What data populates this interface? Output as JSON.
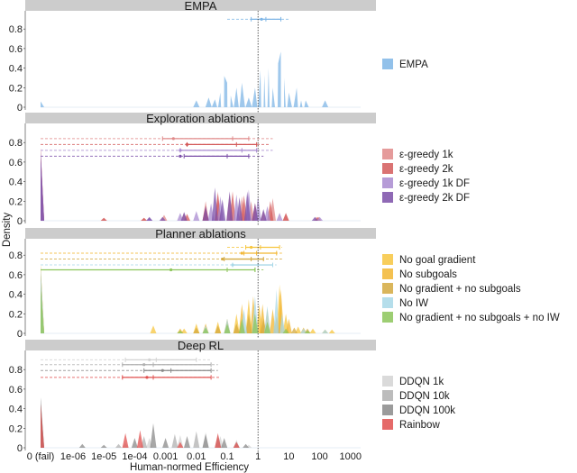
{
  "chart_data": {
    "type": "area",
    "title": "",
    "xlabel": "Human-normed Efficiency",
    "ylabel": "Density",
    "x_scale": "log10 with separate '0 (fail)' category",
    "x_ticks": [
      "0 (fail)",
      "1e-06",
      "1e-05",
      "1e-04",
      "0.001",
      "0.01",
      "0.1",
      "1",
      "10",
      "100",
      "1000"
    ],
    "y_ticks": [
      "0",
      "0.2",
      "0.4",
      "0.6",
      "0.8"
    ],
    "ylim": [
      0,
      0.95
    ],
    "reference_line": {
      "x": 1,
      "style": "dotted"
    },
    "legend_placement": "right",
    "panels": [
      {
        "title": "EMPA",
        "series": [
          {
            "name": "EMPA",
            "color": "#7fb6e6",
            "fail_density": 0.06,
            "peaks": [
              [
                0.01,
                0.07
              ],
              [
                0.025,
                0.1
              ],
              [
                0.04,
                0.08
              ],
              [
                0.06,
                0.15
              ],
              [
                0.08,
                0.32
              ],
              [
                0.1,
                0.25
              ],
              [
                0.13,
                0.12
              ],
              [
                0.2,
                0.2
              ],
              [
                0.3,
                0.25
              ],
              [
                0.5,
                0.1
              ],
              [
                0.8,
                0.2
              ],
              [
                1.2,
                0.38
              ],
              [
                1.6,
                0.33
              ],
              [
                2.2,
                0.4
              ],
              [
                3.0,
                0.2
              ],
              [
                4.5,
                0.45
              ],
              [
                5.5,
                0.57
              ],
              [
                7,
                0.3
              ],
              [
                10,
                0.15
              ],
              [
                18,
                0.2
              ],
              [
                25,
                0.07
              ],
              [
                35,
                0.07
              ],
              [
                150,
                0.07
              ]
            ],
            "interval": {
              "mean": 1.3,
              "inner": [
                0.6,
                1.8
              ],
              "outer": [
                0.6,
                5.5
              ],
              "dash_from": 0.1,
              "dash_to": 10,
              "level": 0.9
            }
          }
        ]
      },
      {
        "title": "Exploration ablations",
        "series": [
          {
            "name": "ε-greedy 1k",
            "color": "#e08a8a",
            "fail_density": 0.75,
            "peaks": [
              [
                1e-05,
                0.03
              ],
              [
                0.0002,
                0.03
              ],
              [
                0.0009,
                0.06
              ],
              [
                0.004,
                0.08
              ],
              [
                0.02,
                0.2
              ],
              [
                0.05,
                0.3
              ],
              [
                0.12,
                0.28
              ],
              [
                0.3,
                0.25
              ],
              [
                0.6,
                0.2
              ],
              [
                1.5,
                0.1
              ],
              [
                3,
                0.23
              ],
              [
                8,
                0.07
              ],
              [
                80,
                0.04
              ]
            ],
            "interval": {
              "mean": 0.0018,
              "inner": [
                0.0008,
                0.15
              ],
              "outer": [
                0.0008,
                0.5
              ],
              "dash_from": 0,
              "dash_to": 3,
              "level": 0.84
            }
          },
          {
            "name": "ε-greedy 2k",
            "color": "#d45a5a",
            "fail_density": 0.74,
            "peaks": [
              [
                1e-05,
                0.03
              ],
              [
                0.0002,
                0.03
              ],
              [
                0.005,
                0.07
              ],
              [
                0.02,
                0.15
              ],
              [
                0.05,
                0.28
              ],
              [
                0.15,
                0.3
              ],
              [
                0.35,
                0.26
              ],
              [
                0.8,
                0.18
              ],
              [
                2.5,
                0.2
              ],
              [
                8,
                0.08
              ],
              [
                90,
                0.04
              ]
            ],
            "interval": {
              "mean": 0.005,
              "inner": [
                0.005,
                0.2
              ],
              "outer": [
                0.005,
                0.9
              ],
              "dash_from": 0,
              "dash_to": 2.5,
              "level": 0.78
            }
          },
          {
            "name": "ε-greedy 1k DF",
            "color": "#a98bd0",
            "fail_density": 0.72,
            "peaks": [
              [
                0.0003,
                0.03
              ],
              [
                0.003,
                0.08
              ],
              [
                0.01,
                0.1
              ],
              [
                0.03,
                0.18
              ],
              [
                0.06,
                0.25
              ],
              [
                0.2,
                0.27
              ],
              [
                0.5,
                0.32
              ],
              [
                1.0,
                0.25
              ],
              [
                2,
                0.15
              ],
              [
                5,
                0.08
              ],
              [
                100,
                0.04
              ]
            ],
            "interval": {
              "mean": 0.003,
              "inner": [
                0.003,
                0.3
              ],
              "outer": [
                0.003,
                0.9
              ],
              "dash_from": 0,
              "dash_to": 3,
              "level": 0.72
            }
          },
          {
            "name": "ε-greedy 2k DF",
            "color": "#7b4fa8",
            "fail_density": 0.7,
            "peaks": [
              [
                0.0003,
                0.04
              ],
              [
                0.0008,
                0.04
              ],
              [
                0.004,
                0.09
              ],
              [
                0.02,
                0.15
              ],
              [
                0.04,
                0.34
              ],
              [
                0.07,
                0.22
              ],
              [
                0.12,
                0.3
              ],
              [
                0.25,
                0.24
              ],
              [
                0.45,
                0.3
              ],
              [
                0.8,
                0.18
              ],
              [
                1.5,
                0.12
              ],
              [
                70,
                0.04
              ]
            ],
            "interval": {
              "mean": 0.003,
              "inner": [
                0.004,
                0.1
              ],
              "outer": [
                0.004,
                0.5
              ],
              "dash_from": 0,
              "dash_to": 1.5,
              "level": 0.66
            }
          }
        ]
      },
      {
        "title": "Planner ablations",
        "series": [
          {
            "name": "No goal gradient",
            "color": "#f7c63f",
            "fail_density": 0.7,
            "peaks": [
              [
                0.0004,
                0.08
              ],
              [
                0.004,
                0.05
              ],
              [
                0.01,
                0.1
              ],
              [
                0.05,
                0.12
              ],
              [
                0.2,
                0.2
              ],
              [
                0.5,
                0.35
              ],
              [
                1.1,
                0.3
              ],
              [
                2,
                0.25
              ],
              [
                5,
                0.5
              ],
              [
                8,
                0.2
              ],
              [
                20,
                0.07
              ],
              [
                60,
                0.05
              ],
              [
                250,
                0.04
              ]
            ],
            "interval": {
              "mean": 0.6,
              "inner": [
                0.4,
                1.2
              ],
              "outer": [
                0.4,
                5
              ],
              "dash_from": 0.1,
              "dash_to": 6,
              "level": 0.88
            }
          },
          {
            "name": "No subgoals",
            "color": "#f2b632",
            "fail_density": 0.7,
            "peaks": [
              [
                0.003,
                0.05
              ],
              [
                0.02,
                0.1
              ],
              [
                0.1,
                0.15
              ],
              [
                0.3,
                0.3
              ],
              [
                0.7,
                0.38
              ],
              [
                1.4,
                0.3
              ],
              [
                3,
                0.25
              ],
              [
                5.5,
                0.45
              ],
              [
                10,
                0.15
              ],
              [
                30,
                0.06
              ],
              [
                150,
                0.04
              ]
            ],
            "interval": {
              "mean": 0.3,
              "inner": [
                0.35,
                0.9
              ],
              "outer": [
                0.35,
                4
              ],
              "dash_from": 0,
              "dash_to": 6,
              "level": 0.82
            }
          },
          {
            "name": "No gradient + no subgoals",
            "color": "#d4a93f",
            "fail_density": 0.65,
            "peaks": [
              [
                0.01,
                0.06
              ],
              [
                0.05,
                0.08
              ],
              [
                0.2,
                0.1
              ],
              [
                0.5,
                0.2
              ],
              [
                1.5,
                0.15
              ],
              [
                4,
                0.18
              ],
              [
                15,
                0.06
              ],
              [
                40,
                0.05
              ]
            ],
            "interval": {
              "mean": 0.07,
              "inner": [
                0.08,
                0.6
              ],
              "outer": [
                0.08,
                1.5
              ],
              "dash_from": 0,
              "dash_to": 6,
              "level": 0.76
            }
          },
          {
            "name": "No IW",
            "color": "#a8d8e8",
            "fail_density": 0.68,
            "peaks": [
              [
                0.02,
                0.08
              ],
              [
                0.1,
                0.15
              ],
              [
                0.35,
                0.25
              ],
              [
                0.8,
                0.38
              ],
              [
                2,
                0.28
              ],
              [
                4,
                0.45
              ],
              [
                6,
                0.2
              ],
              [
                30,
                0.05
              ],
              [
                150,
                0.04
              ]
            ],
            "interval": {
              "mean": 0.15,
              "inner": [
                0.15,
                1.0
              ],
              "outer": [
                0.15,
                3
              ],
              "dash_from": 0,
              "dash_to": 4,
              "level": 0.7
            }
          },
          {
            "name": "No gradient + no subgoals + no IW",
            "color": "#8cc55a",
            "fail_density": 0.48,
            "peaks": [
              [
                0.003,
                0.03
              ],
              [
                0.02,
                0.06
              ],
              [
                0.1,
                0.1
              ],
              [
                0.3,
                0.15
              ],
              [
                0.8,
                0.2
              ],
              [
                2,
                0.12
              ],
              [
                8,
                0.05
              ],
              [
                40,
                0.03
              ]
            ],
            "interval": {
              "mean": 0.0015,
              "inner": [
                0.1,
                0.8
              ],
              "outer": [
                0,
                0.8
              ],
              "dash_from": 0,
              "dash_to": 1.5,
              "level": 0.65
            }
          }
        ]
      },
      {
        "title": "Deep RL",
        "series": [
          {
            "name": "DDQN 1k",
            "color": "#d3d3d3",
            "fail_density": 0.5,
            "peaks": [
              [
                5e-05,
                0.05
              ],
              [
                0.0003,
                0.1
              ],
              [
                0.003,
                0.13
              ],
              [
                0.02,
                0.16
              ],
              [
                0.06,
                0.12
              ],
              [
                0.2,
                0.08
              ],
              [
                0.5,
                0.03
              ]
            ],
            "interval": {
              "mean": 0.0003,
              "inner": [
                5e-05,
                0.0005
              ],
              "outer": [
                5e-05,
                0.01
              ],
              "dash_from": 0,
              "dash_to": 0.03,
              "level": 0.9
            }
          },
          {
            "name": "DDQN 10k",
            "color": "#b0b0b0",
            "fail_density": 0.5,
            "peaks": [
              [
                3e-05,
                0.04
              ],
              [
                0.0002,
                0.12
              ],
              [
                0.002,
                0.14
              ],
              [
                0.01,
                0.17
              ],
              [
                0.05,
                0.13
              ],
              [
                0.2,
                0.06
              ]
            ],
            "interval": {
              "mean": 0.0002,
              "inner": [
                4e-05,
                0.0004
              ],
              "outer": [
                4e-05,
                0.03
              ],
              "dash_from": 0,
              "dash_to": 0.05,
              "level": 0.85
            }
          },
          {
            "name": "DDQN 100k",
            "color": "#8a8a8a",
            "fail_density": 0.52,
            "peaks": [
              [
                2e-06,
                0.04
              ],
              [
                1e-05,
                0.03
              ],
              [
                0.0001,
                0.1
              ],
              [
                0.0004,
                0.25
              ],
              [
                0.001,
                0.1
              ],
              [
                0.005,
                0.12
              ],
              [
                0.02,
                0.14
              ],
              [
                0.08,
                0.1
              ],
              [
                0.4,
                0.04
              ]
            ],
            "interval": {
              "mean": 0.0008,
              "inner": [
                0.0002,
                0.0015
              ],
              "outer": [
                0.0002,
                0.03
              ],
              "dash_from": 0,
              "dash_to": 0.05,
              "level": 0.79
            }
          },
          {
            "name": "Rainbow",
            "color": "#e0504f",
            "fail_density": 0.45,
            "peaks": [
              [
                5e-05,
                0.15
              ],
              [
                0.00015,
                0.18
              ],
              [
                0.003,
                0.06
              ],
              [
                0.05,
                0.15
              ],
              [
                0.2,
                0.06
              ]
            ],
            "interval": {
              "mean": 0.00025,
              "inner": [
                4e-05,
                0.0004
              ],
              "outer": [
                4e-05,
                0.03
              ],
              "dash_from": 0,
              "dash_to": 0.06,
              "level": 0.72
            }
          }
        ]
      }
    ]
  }
}
